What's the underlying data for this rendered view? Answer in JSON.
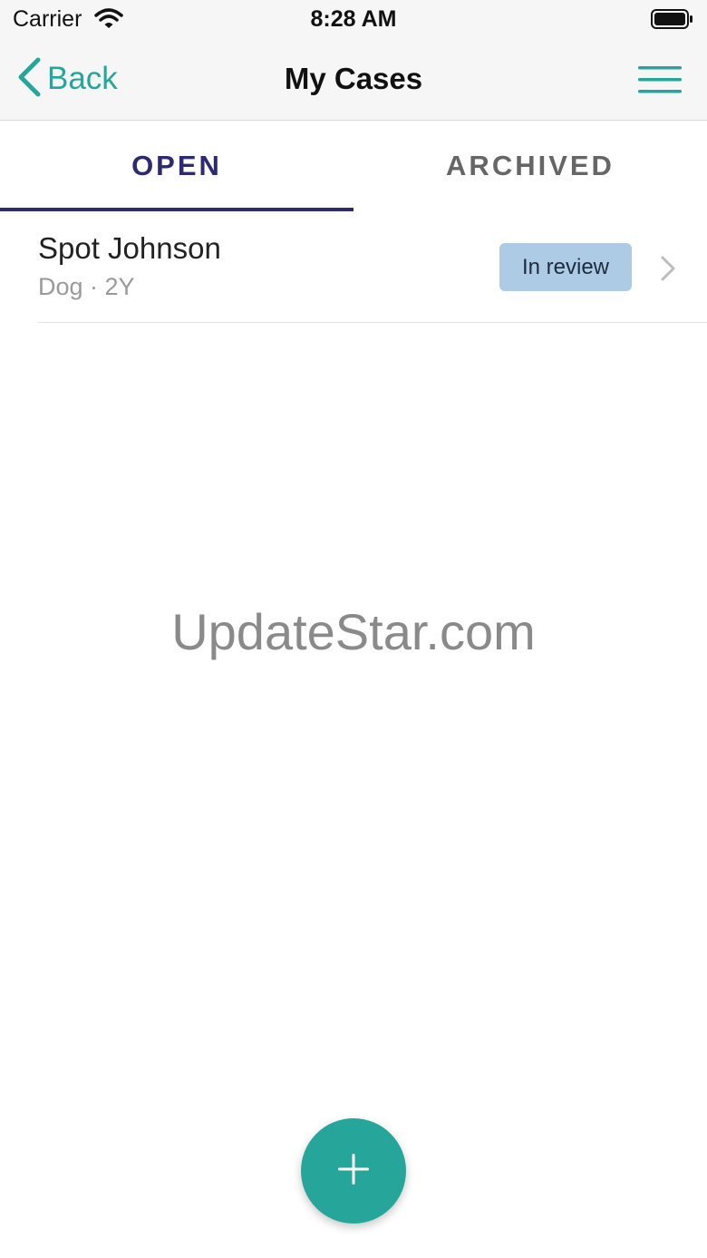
{
  "status_bar": {
    "carrier": "Carrier",
    "time": "8:28 AM",
    "wifi_icon": "wifi-icon",
    "battery_icon": "battery-icon"
  },
  "nav": {
    "back_label": "Back",
    "back_icon": "chevron-left-icon",
    "title": "My Cases",
    "menu_icon": "hamburger-menu-icon"
  },
  "tabs": [
    {
      "label": "OPEN",
      "selected": true
    },
    {
      "label": "ARCHIVED",
      "selected": false
    }
  ],
  "cases": [
    {
      "name": "Spot Johnson",
      "meta": "Dog · 2Y",
      "status": "In review",
      "status_color": "#aecbe6"
    }
  ],
  "watermark": "UpdateStar.com",
  "fab": {
    "icon": "plus-icon",
    "color": "#26a69a"
  },
  "colors": {
    "accent": "#26a69a",
    "tab_active": "#2b2a72",
    "tab_inactive": "#666666"
  }
}
